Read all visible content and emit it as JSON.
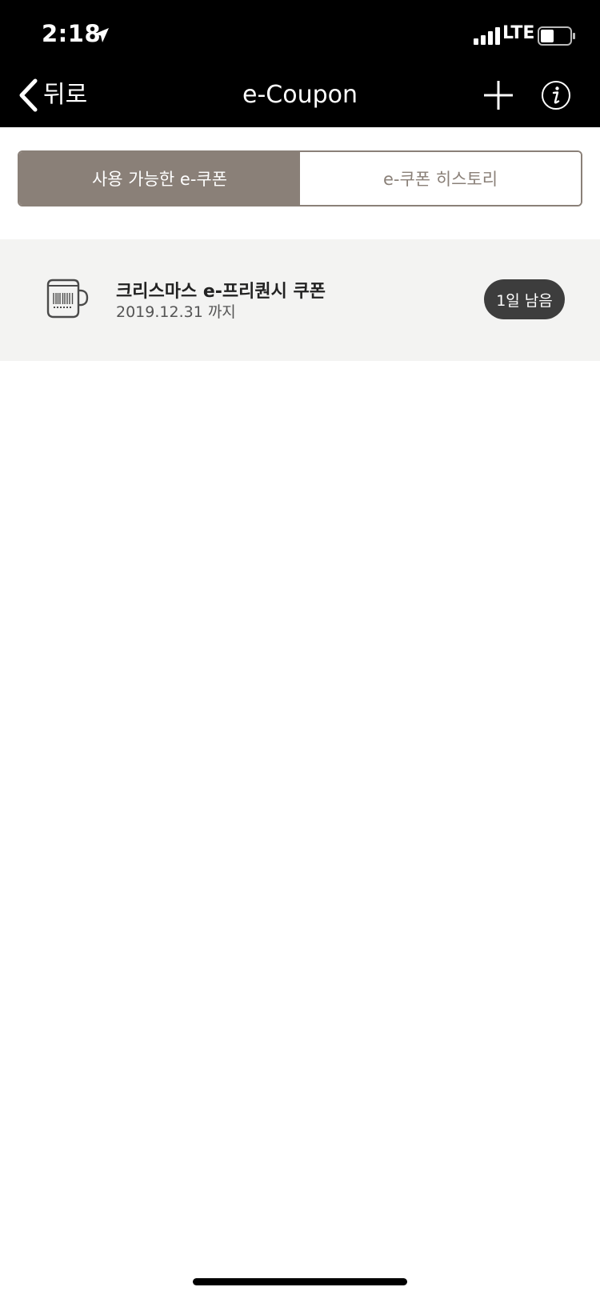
{
  "status_bar": {
    "time": "2:18",
    "network": "LTE"
  },
  "nav": {
    "back_label": "뒤로",
    "title": "e-Coupon"
  },
  "tabs": [
    {
      "label": "사용 가능한 e-쿠폰",
      "active": true
    },
    {
      "label": "e-쿠폰 히스토리",
      "active": false
    }
  ],
  "coupons": [
    {
      "title": "크리스마스 e-프리퀀시 쿠폰",
      "expiry": "2019.12.31 까지",
      "badge": "1일 남음"
    }
  ],
  "colors": {
    "header_bg": "#000000",
    "segment_active": "#8a8078",
    "coupon_row_bg": "#f3f3f2",
    "badge_bg": "#3d3d3d"
  },
  "icons": {
    "back": "chevron-left-icon",
    "add": "plus-icon",
    "info": "info-icon",
    "coupon": "coffee-mug-barcode-icon"
  }
}
